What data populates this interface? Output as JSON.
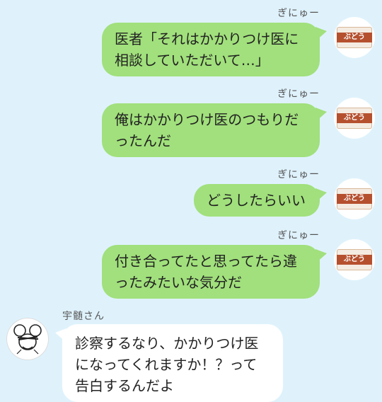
{
  "colors": {
    "background": "#dff2fc",
    "outgoing_bubble": "#a1e07c",
    "incoming_bubble": "#ffffff"
  },
  "messages": [
    {
      "sender": "ぎにゅー",
      "text": "医者「それはかかりつけ医に\n相談していただいて…」",
      "avatar_icon": "snack-package-icon"
    },
    {
      "sender": "ぎにゅー",
      "text": "俺はかかりつけ医のつもりだ\nったんだ",
      "avatar_icon": "snack-package-icon"
    },
    {
      "sender": "ぎにゅー",
      "text": "どうしたらいい",
      "avatar_icon": "snack-package-icon"
    },
    {
      "sender": "ぎにゅー",
      "text": "付き合ってたと思ってたら違\nったみたいな気分だ",
      "avatar_icon": "snack-package-icon"
    },
    {
      "sender": "宇髄さん",
      "text": "診察するなり、かかりつけ医\nになってくれますか！？って\n告白するんだよ",
      "avatar_icon": "mouse-doodle-icon"
    }
  ]
}
